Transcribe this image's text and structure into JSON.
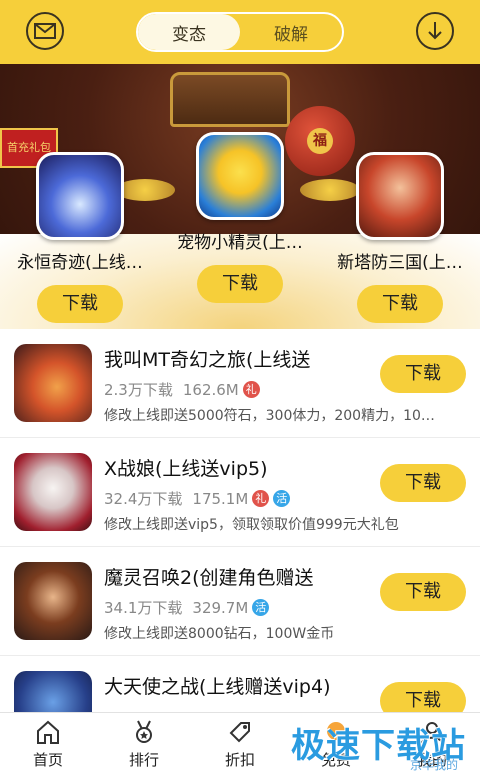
{
  "header": {
    "tabs": [
      {
        "label": "变态",
        "active": true
      },
      {
        "label": "破解",
        "active": false
      }
    ],
    "left_icon": "mail-icon",
    "right_icon": "download-circle-icon",
    "accent": "#f6cf3a"
  },
  "banner": {
    "badge_text": "首充礼包",
    "featured": [
      {
        "name": "永恒奇迹(上线…",
        "button": "下载"
      },
      {
        "name": "宠物小精灵(上…",
        "button": "下载"
      },
      {
        "name": "新塔防三国(上…",
        "button": "下载"
      }
    ]
  },
  "games": [
    {
      "title": "我叫MT奇幻之旅(上线送",
      "downloads": "2.3万下载",
      "size": "162.6M",
      "tags": [
        "礼"
      ],
      "desc": "修改上线即送5000符石，300体力，200精力，10…",
      "button": "下载"
    },
    {
      "title": "X战娘(上线送vip5)",
      "downloads": "32.4万下载",
      "size": "175.1M",
      "tags": [
        "礼",
        "活"
      ],
      "desc": "修改上线即送vip5，领取领取价值999元大礼包",
      "button": "下载"
    },
    {
      "title": "魔灵召唤2(创建角色赠送",
      "downloads": "34.1万下载",
      "size": "329.7M",
      "tags": [
        "活"
      ],
      "desc": "修改上线即送8000钻石，100W金币",
      "button": "下载"
    },
    {
      "title": "大天使之战(上线赠送vip4)",
      "downloads": "",
      "size": "",
      "tags": [],
      "desc": "",
      "button": "下载"
    }
  ],
  "nav": [
    {
      "label": "首页",
      "icon": "home-icon"
    },
    {
      "label": "排行",
      "icon": "medal-icon"
    },
    {
      "label": "折扣",
      "icon": "tag-icon"
    },
    {
      "label": "免费",
      "icon": "gift-icon"
    },
    {
      "label": "我的",
      "icon": "user-icon"
    }
  ],
  "watermark": {
    "main": "极速下载站",
    "sub": "京华我的"
  }
}
